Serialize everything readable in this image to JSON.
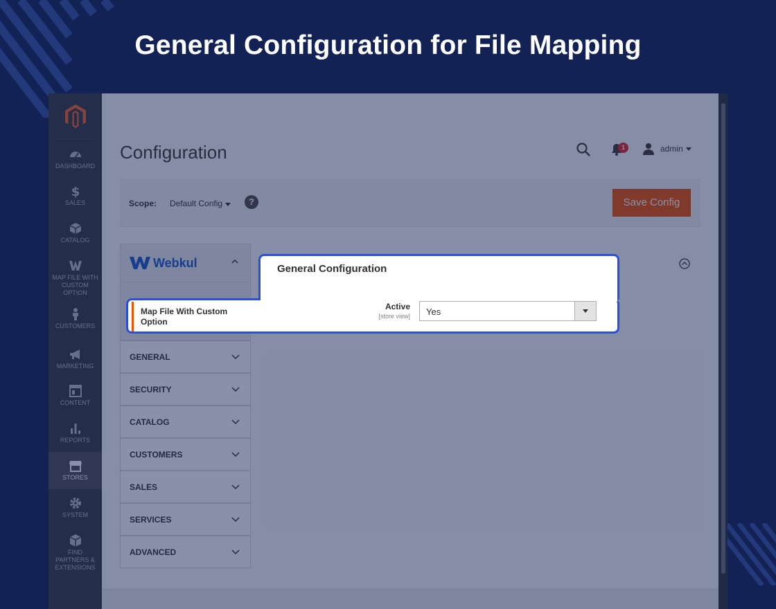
{
  "banner": {
    "title": "General Configuration for File Mapping"
  },
  "sidebar": {
    "items": [
      {
        "label": "DASHBOARD",
        "icon": "dashboard-icon"
      },
      {
        "label": "SALES",
        "icon": "dollar-icon"
      },
      {
        "label": "CATALOG",
        "icon": "box-icon"
      },
      {
        "label": "MAP FILE WITH CUSTOM OPTION",
        "icon": "webkul-icon"
      },
      {
        "label": "CUSTOMERS",
        "icon": "person-icon"
      },
      {
        "label": "MARKETING",
        "icon": "megaphone-icon"
      },
      {
        "label": "CONTENT",
        "icon": "layout-icon"
      },
      {
        "label": "REPORTS",
        "icon": "bar-chart-icon"
      },
      {
        "label": "STORES",
        "icon": "store-icon",
        "active": true
      },
      {
        "label": "SYSTEM",
        "icon": "gear-icon"
      },
      {
        "label": "FIND PARTNERS & EXTENSIONS",
        "icon": "cube-icon"
      }
    ]
  },
  "header": {
    "page_title": "Configuration",
    "notification_count": "1",
    "user_name": "admin"
  },
  "scope": {
    "label": "Scope:",
    "value": "Default Config",
    "help": "?"
  },
  "toolbar": {
    "save_label": "Save Config"
  },
  "config_nav": {
    "vendor": "Webkul",
    "sections": [
      "GENERAL",
      "SECURITY",
      "CATALOG",
      "CUSTOMERS",
      "SALES",
      "SERVICES",
      "ADVANCED"
    ]
  },
  "highlight": {
    "group_title": "General Configuration",
    "link_label": "Map File With Custom Option",
    "field_label": "Active",
    "field_scope": "[store view]",
    "field_value": "Yes"
  },
  "colors": {
    "banner_bg": "#132254",
    "accent": "#eb5202",
    "highlight_border": "#2b50d6",
    "webkul_blue": "#1a58c7"
  }
}
